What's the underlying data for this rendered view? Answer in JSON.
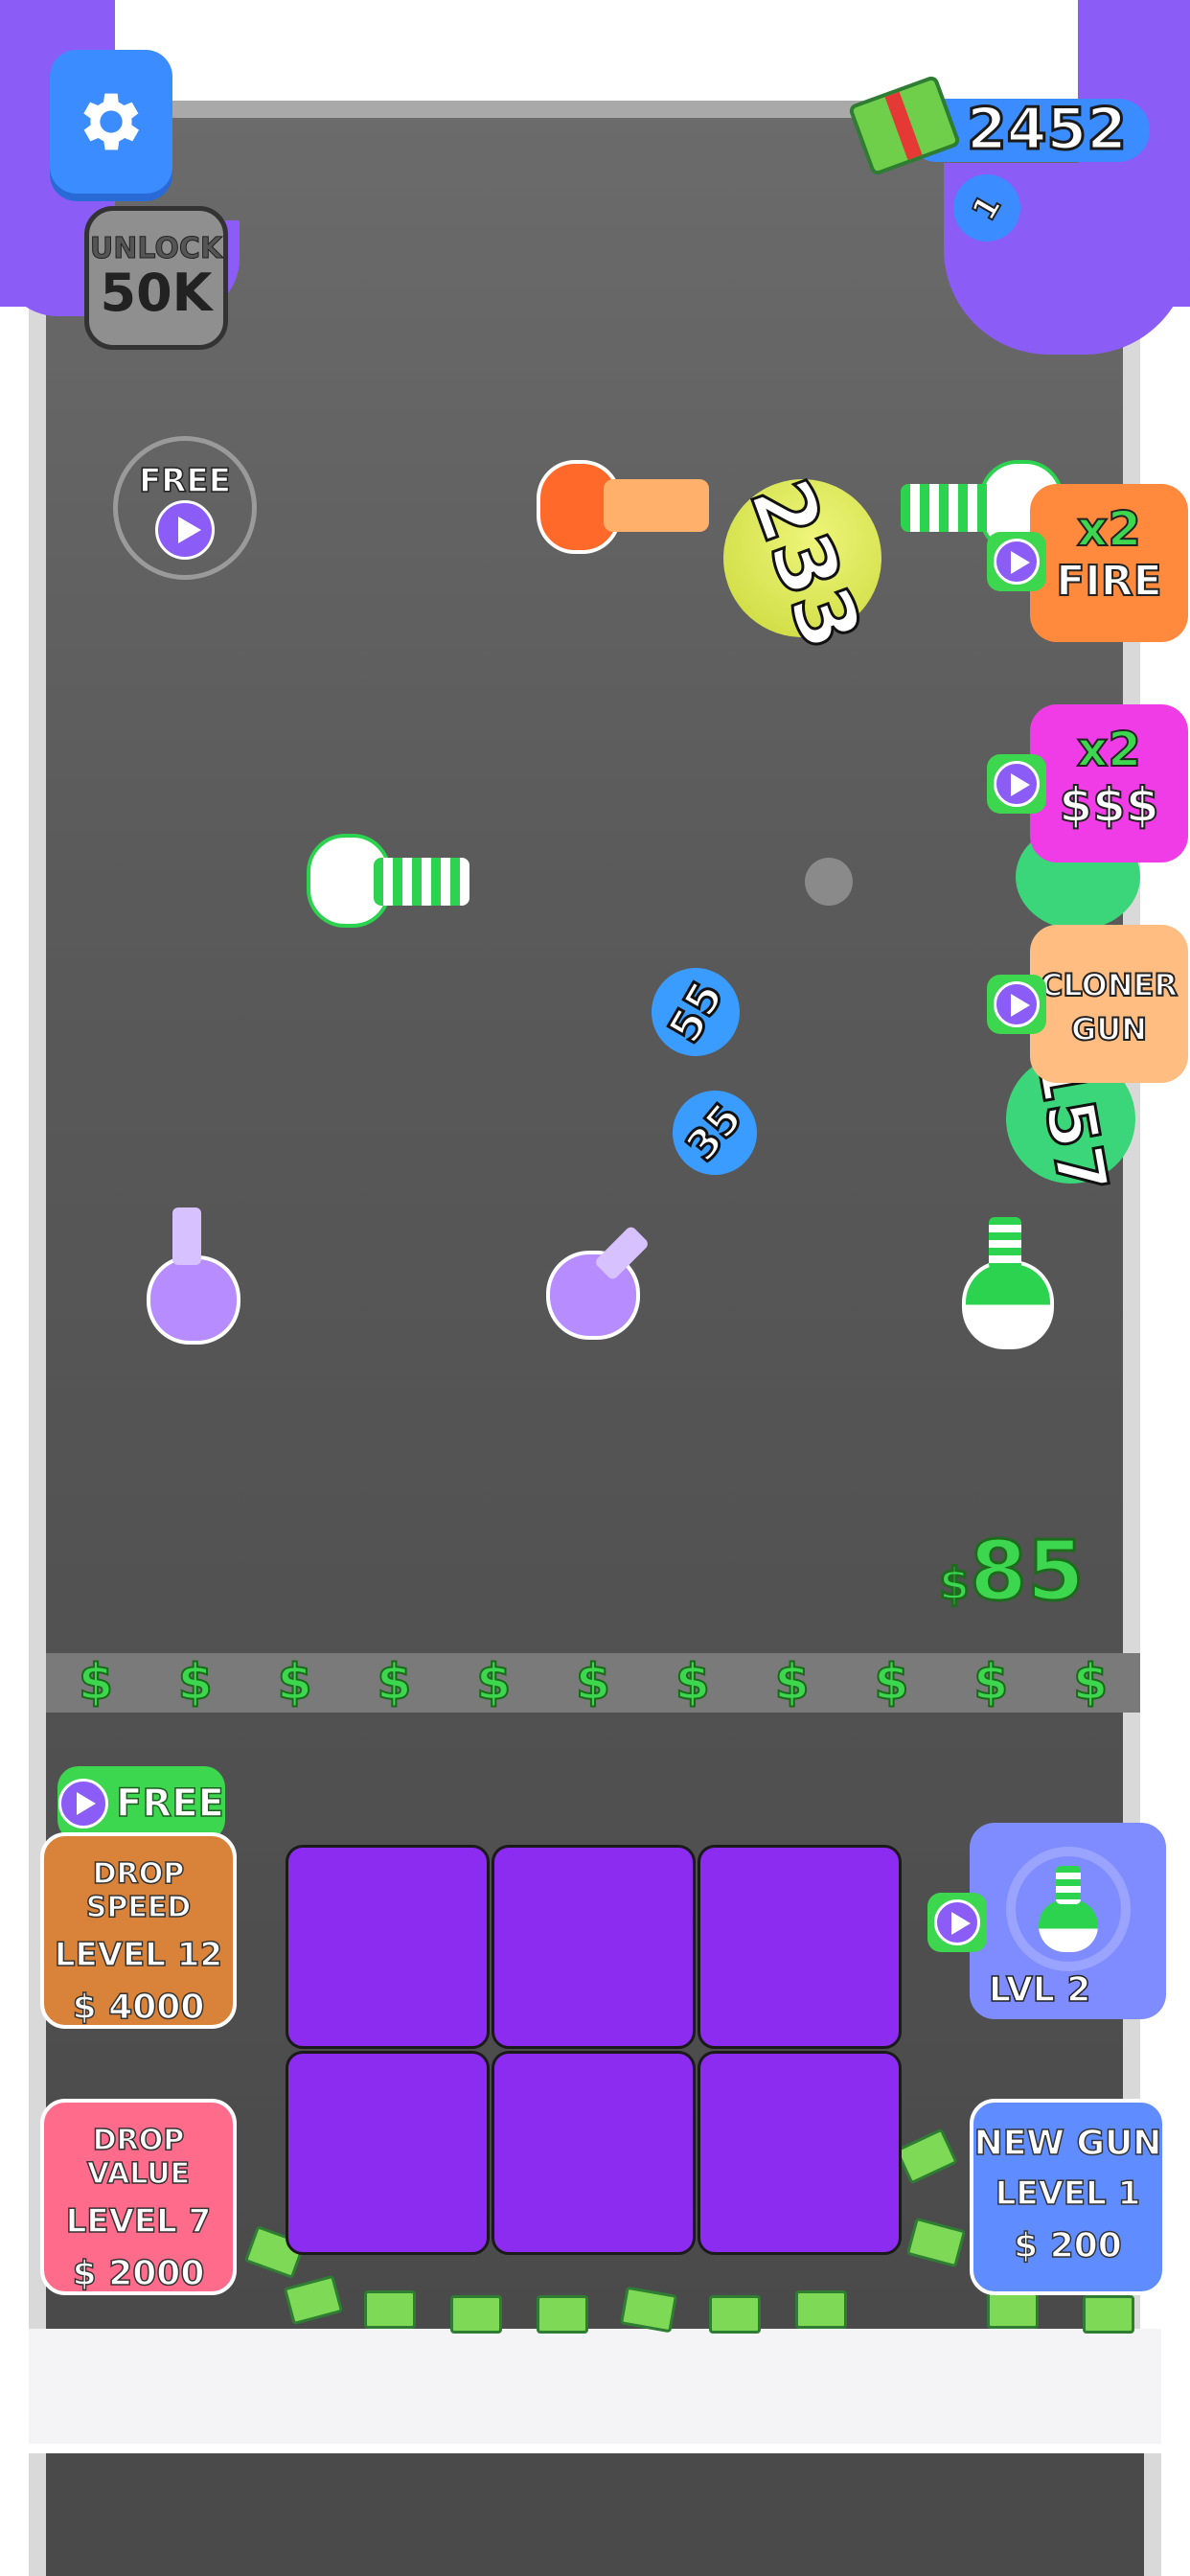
{
  "hud": {
    "cash": "2452",
    "level": "1",
    "unlock_line1": "UNLOCK",
    "unlock_line2": "50K"
  },
  "free_reward": {
    "label": "FREE"
  },
  "boosters": [
    {
      "line1": "x2",
      "line2": "FIRE",
      "color": "#ff8a3d"
    },
    {
      "line1": "x2",
      "line2": "$$$",
      "color": "#f03ce6"
    },
    {
      "line1": "CLONER",
      "line2": "GUN",
      "color": "#ffbd82"
    }
  ],
  "balls": [
    {
      "value": "233",
      "color": "#d6e84a"
    },
    {
      "value": "55",
      "color": "#3b9cff"
    },
    {
      "value": "35",
      "color": "#3b9cff"
    },
    {
      "value": "157",
      "color": "#3cd67a"
    }
  ],
  "earn": {
    "symbol": "$",
    "value": "85"
  },
  "lane_symbol": "$",
  "upgrades": {
    "free_label": "FREE",
    "drop_speed": {
      "title": "DROP SPEED",
      "level": "LEVEL 12",
      "price": "$ 4000",
      "color": "#d9823a"
    },
    "drop_value": {
      "title": "DROP VALUE",
      "level": "LEVEL 7",
      "price": "$ 2000",
      "color": "#ff6b8a"
    },
    "new_gun": {
      "title": "NEW GUN",
      "level": "LEVEL 1",
      "price": "$ 200",
      "color": "#5f8dff"
    },
    "gun_level": "LVL 2"
  }
}
